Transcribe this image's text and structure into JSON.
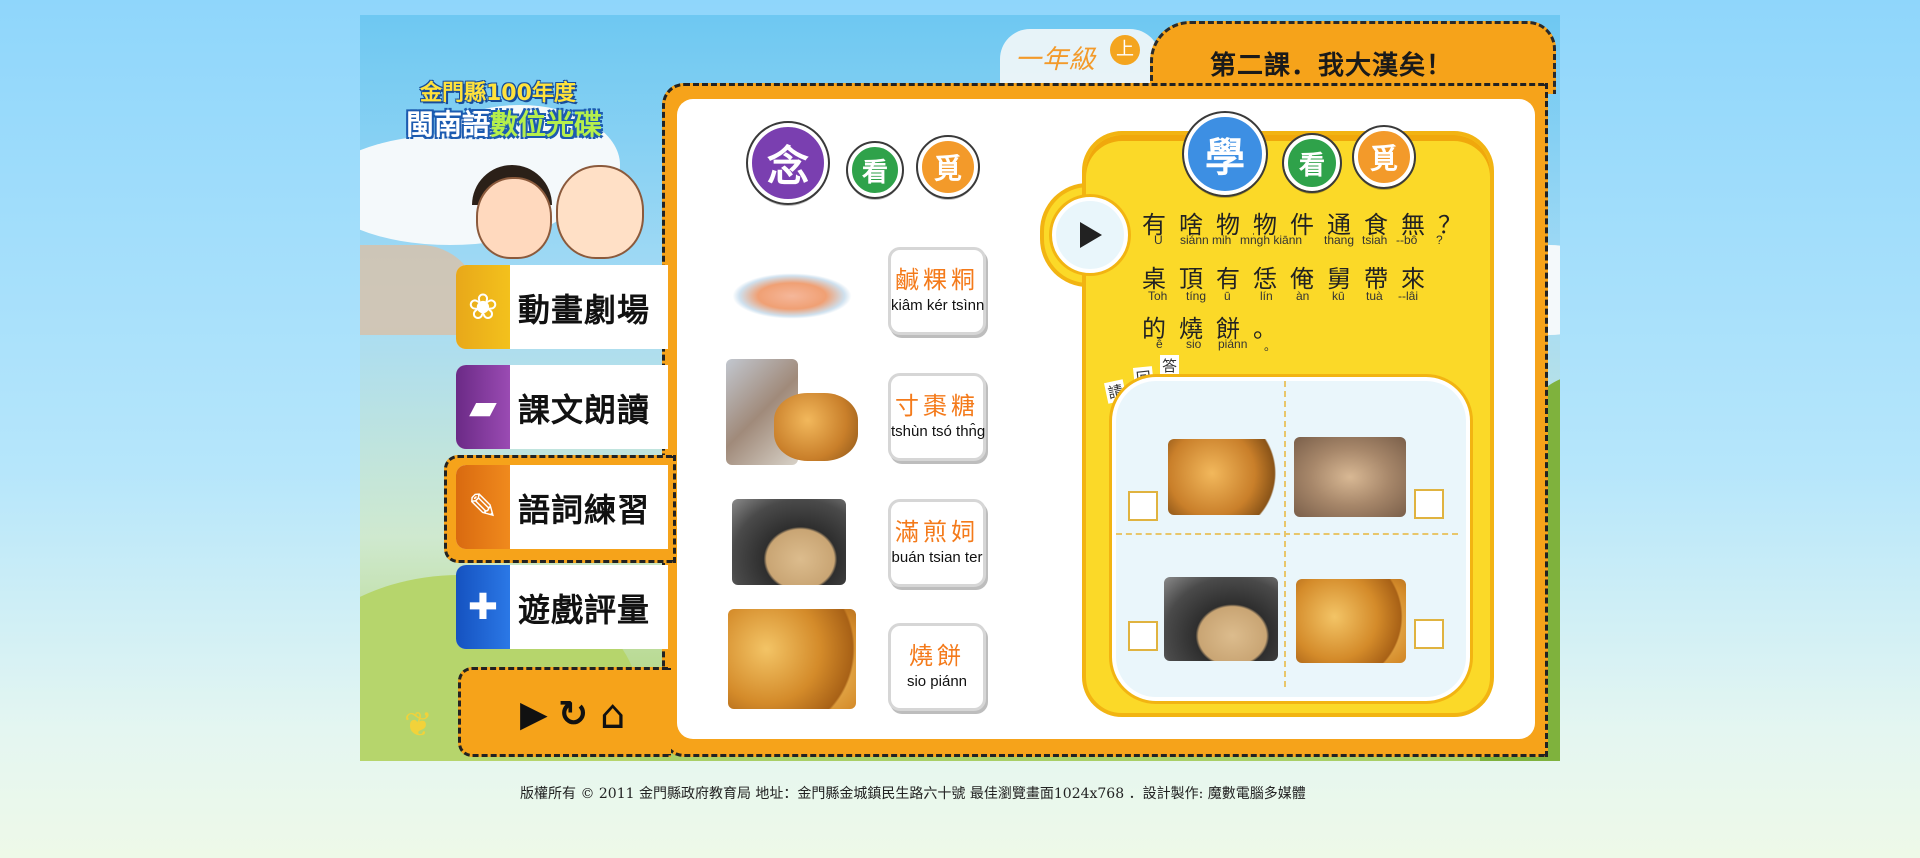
{
  "header": {
    "grade_label": "一年級",
    "grade_badge": "上",
    "lesson_title": "第二課．我大漢矣！"
  },
  "logo": {
    "line1": "金門縣100年度",
    "line2_a": "閩南語",
    "line2_b": "數位光碟"
  },
  "nav": {
    "items": [
      {
        "label": "動畫劇場",
        "icon": "film-icon",
        "color": "#f3c11c"
      },
      {
        "label": "課文朗讀",
        "icon": "book-icon",
        "color": "#8a3fa3"
      },
      {
        "label": "語詞練習",
        "icon": "pencil-icon",
        "color": "#e87512"
      },
      {
        "label": "遊戲評量",
        "icon": "gamepad-icon",
        "color": "#1a64d6"
      }
    ]
  },
  "controls": {
    "play": "▶",
    "replay": "↻",
    "home": "⌂"
  },
  "practice": {
    "title": [
      "念",
      "看",
      "覓"
    ],
    "words": [
      {
        "han": "鹹粿粡",
        "rom": "kiâm kér tsìnn",
        "food": "candy"
      },
      {
        "han": "寸棗糖",
        "rom": "tshùn tsó thn̂g",
        "food": "fried-dough"
      },
      {
        "han": "滿煎㚸",
        "rom": "buán tsian ter",
        "food": "pancake"
      },
      {
        "han": "燒餅",
        "rom": "sio piánn",
        "food": "buns"
      }
    ]
  },
  "quiz": {
    "title": [
      "學",
      "看",
      "覓"
    ],
    "lines": [
      {
        "han": "有啥物物件通食無？",
        "rom": [
          "Ū",
          "siánn mih",
          "mn̍gh kiānn",
          "thang",
          "tsiah",
          "--bô",
          "?"
        ]
      },
      {
        "han": "桌頂有恁俺舅帶來",
        "rom": [
          "Toh",
          "tíng",
          "ū",
          "lín",
          "àn",
          "kū",
          "tuà",
          "--lâi"
        ]
      },
      {
        "han": "的燒餅。",
        "rom": [
          "ê",
          "sio",
          "piánn",
          "。"
        ]
      }
    ],
    "answer_prompt": [
      "請",
      "回",
      "答"
    ],
    "options": [
      "fried-dough",
      "dried-fruit",
      "pancake",
      "buns"
    ]
  },
  "footer": {
    "text": "版權所有 © 2011  金門縣政府教育局  地址：金門縣金城鎮民生路六十號  最佳瀏覽畫面1024x768  ．設計製作: 魔數電腦多媒體"
  },
  "colors": {
    "orange": "#f6a31a",
    "yellow": "#fbd928",
    "accent_text": "#f47a1a"
  }
}
